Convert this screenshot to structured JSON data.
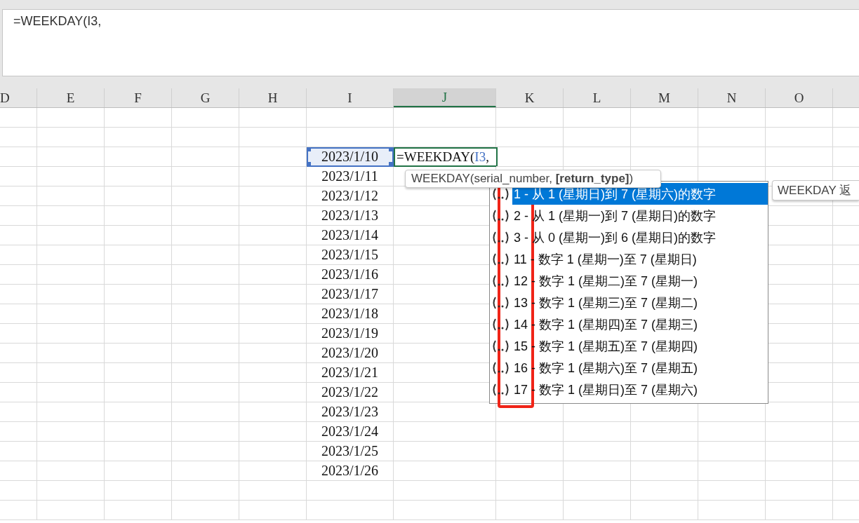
{
  "formula_bar": {
    "value": "=WEEKDAY(I3,"
  },
  "columns": [
    {
      "label": "D",
      "selected": false
    },
    {
      "label": "E",
      "selected": false
    },
    {
      "label": "F",
      "selected": false
    },
    {
      "label": "G",
      "selected": false
    },
    {
      "label": "H",
      "selected": false
    },
    {
      "label": "I",
      "selected": false
    },
    {
      "label": "J",
      "selected": true
    },
    {
      "label": "K",
      "selected": false
    },
    {
      "label": "L",
      "selected": false
    },
    {
      "label": "M",
      "selected": false
    },
    {
      "label": "N",
      "selected": false
    },
    {
      "label": "O",
      "selected": false
    }
  ],
  "dates": [
    {
      "value": "2023/1/10",
      "selected": true
    },
    {
      "value": "2023/1/11",
      "selected": false
    },
    {
      "value": "2023/1/12",
      "selected": false
    },
    {
      "value": "2023/1/13",
      "selected": false
    },
    {
      "value": "2023/1/14",
      "selected": false
    },
    {
      "value": "2023/1/15",
      "selected": false
    },
    {
      "value": "2023/1/16",
      "selected": false
    },
    {
      "value": "2023/1/17",
      "selected": false
    },
    {
      "value": "2023/1/18",
      "selected": false
    },
    {
      "value": "2023/1/19",
      "selected": false
    },
    {
      "value": "2023/1/20",
      "selected": false
    },
    {
      "value": "2023/1/21",
      "selected": false
    },
    {
      "value": "2023/1/22",
      "selected": false
    },
    {
      "value": "2023/1/23",
      "selected": false
    },
    {
      "value": "2023/1/24",
      "selected": false
    },
    {
      "value": "2023/1/25",
      "selected": false
    },
    {
      "value": "2023/1/26",
      "selected": false
    }
  ],
  "edit_cell": {
    "parts": [
      {
        "text": "=WEEKDAY(",
        "kind": "plain"
      },
      {
        "text": "I3",
        "kind": "reference"
      },
      {
        "text": ",",
        "kind": "plain"
      }
    ]
  },
  "syntax_tooltip": {
    "text": "WEEKDAY(serial_number, **[return_type]**)"
  },
  "dropdown": {
    "items": [
      {
        "label": "1 - 从 1 (星期日)到 7 (星期六)的数字",
        "selected": true
      },
      {
        "label": "2 - 从 1 (星期一)到 7 (星期日)的数字",
        "selected": false
      },
      {
        "label": "3 - 从 0 (星期一)到 6 (星期日)的数字",
        "selected": false
      },
      {
        "label": "11 - 数字 1 (星期一)至 7 (星期日)",
        "selected": false
      },
      {
        "label": "12 - 数字 1 (星期二)至 7 (星期一)",
        "selected": false
      },
      {
        "label": "13 - 数字 1 (星期三)至 7 (星期二)",
        "selected": false
      },
      {
        "label": "14 - 数字 1 (星期四)至 7 (星期三)",
        "selected": false
      },
      {
        "label": "15 - 数字 1 (星期五)至 7 (星期四)",
        "selected": false
      },
      {
        "label": "16 - 数字 1 (星期六)至 7 (星期五)",
        "selected": false
      },
      {
        "label": "17 - 数字 1 (星期日)至 7 (星期六)",
        "selected": false
      }
    ]
  },
  "description_tooltip": {
    "text": "WEEKDAY 返"
  }
}
